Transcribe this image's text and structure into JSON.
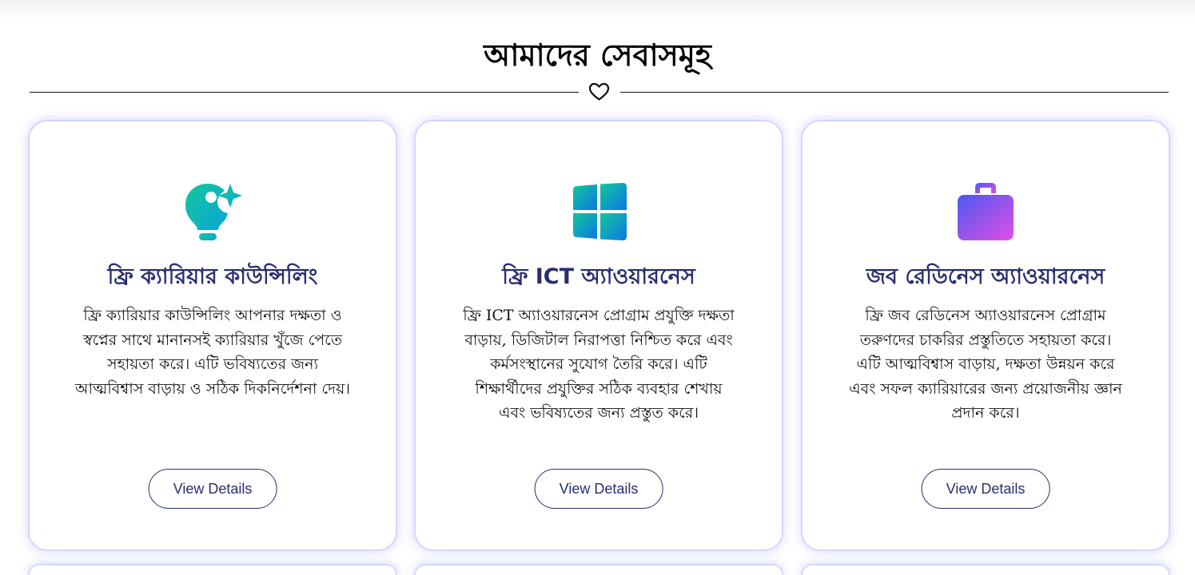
{
  "section": {
    "title": "আমাদের সেবাসমূহ"
  },
  "cards": [
    {
      "icon": "lightbulb-sparkle-icon",
      "title": "ফ্রি ক্যারিয়ার কাউন্সিলিং",
      "description": "ফ্রি ক্যারিয়ার কাউন্সিলিং আপনার দক্ষতা ও স্বপ্নের সাথে মানানসই ক্যারিয়ার খুঁজে পেতে সহায়তা করে। এটি ভবিষ্যতের জন্য আত্মবিশ্বাস বাড়ায় ও সঠিক দিকনির্দেশনা দেয়।",
      "button_label": "View Details"
    },
    {
      "icon": "windows-icon",
      "title": "ফ্রি ICT অ্যাওয়ারনেস",
      "description": "ফ্রি ICT অ্যাওয়ারনেস প্রোগ্রাম প্রযুক্তি দক্ষতা বাড়ায়, ডিজিটাল নিরাপত্তা নিশ্চিত করে এবং কর্মসংস্থানের সুযোগ তৈরি করে। এটি শিক্ষার্থীদের প্রযুক্তির সঠিক ব্যবহার শেখায় এবং ভবিষ্যতের জন্য প্রস্তুত করে।",
      "button_label": "View Details"
    },
    {
      "icon": "briefcase-icon",
      "title": "জব রেডিনেস অ্যাওয়ারনেস",
      "description": "ফ্রি জব রেডিনেস অ্যাওয়ারনেস প্রোগ্রাম তরুণদের চাকরির প্রস্তুতিতে সহায়তা করে। এটি আত্মবিশ্বাস বাড়ায়, দক্ষতা উন্নয়ন করে এবং সফল ক্যারিয়ারের জন্য প্রয়োজনীয় জ্ঞান প্রদান করে।",
      "button_label": "View Details"
    }
  ],
  "colors": {
    "title_text": "#2a2d72",
    "card_glow": "#c4c7ff",
    "icon_green_start": "#12c79a",
    "icon_teal_end": "#0aa6d8",
    "icon_blue_end": "#0b78e6",
    "icon_purple_start": "#4b59f0",
    "icon_pink_end": "#e14fe6"
  }
}
